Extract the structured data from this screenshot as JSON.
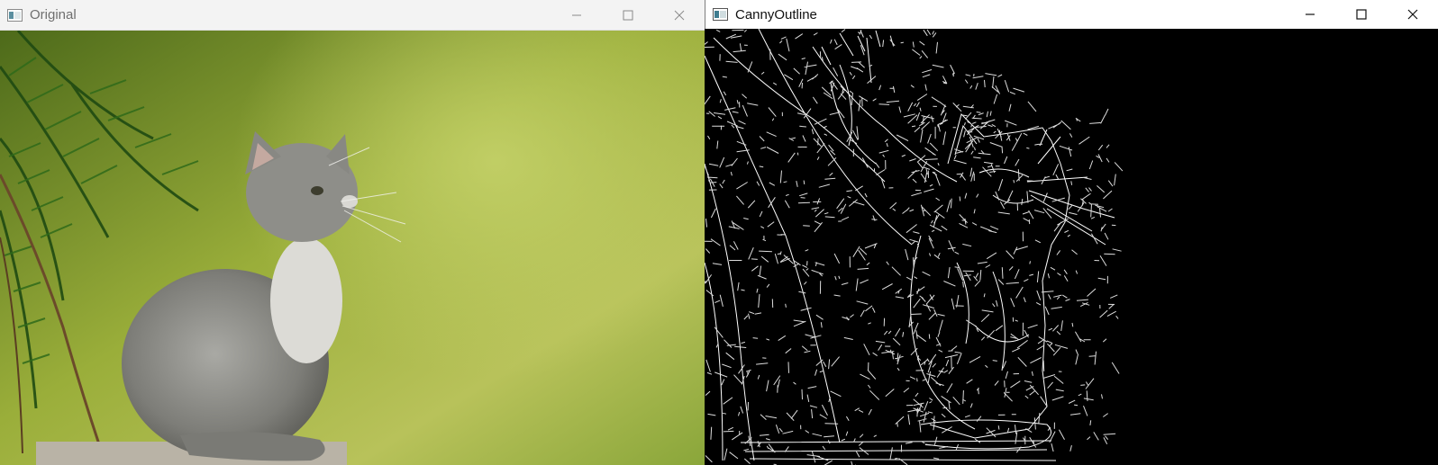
{
  "windows": {
    "original": {
      "title": "Original",
      "icon": "app-window-icon",
      "controls": [
        "minimize-icon",
        "maximize-icon",
        "close-icon"
      ]
    },
    "canny": {
      "title": "CannyOutline",
      "icon": "app-window-icon",
      "controls": [
        "minimize-icon",
        "maximize-icon",
        "close-icon"
      ]
    }
  },
  "colors": {
    "titlebar_inactive": "#f3f3f3",
    "titlebar_active": "#ffffff",
    "edge_background": "#000000",
    "edge_lines": "#ffffff",
    "foliage_green": "#7a9a2a"
  }
}
